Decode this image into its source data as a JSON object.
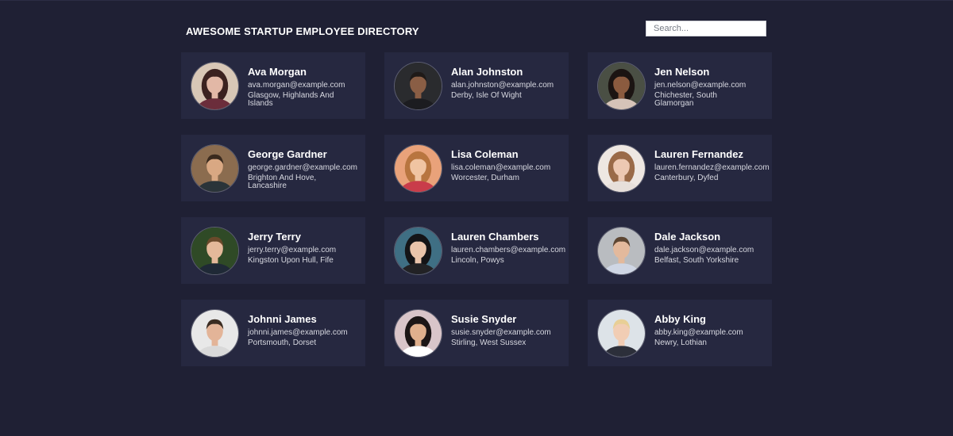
{
  "header": {
    "title": "AWESOME STARTUP EMPLOYEE DIRECTORY",
    "search_placeholder": "Search..."
  },
  "employees": [
    {
      "name": "Ava Morgan",
      "email": "ava.morgan@example.com",
      "location": "Glasgow, Highlands And Islands",
      "avatar": {
        "bg": "#d8c7b6",
        "hair": "#3b2220",
        "skin": "#e2b8a6",
        "shirt": "#6b2d3b",
        "long_hair": true
      }
    },
    {
      "name": "Alan Johnston",
      "email": "alan.johnston@example.com",
      "location": "Derby, Isle Of Wight",
      "avatar": {
        "bg": "#2a2b2e",
        "hair": "#1f1a18",
        "skin": "#8a5e45",
        "shirt": "#1c1c20",
        "long_hair": false
      }
    },
    {
      "name": "Jen Nelson",
      "email": "jen.nelson@example.com",
      "location": "Chichester, South Glamorgan",
      "avatar": {
        "bg": "#4a4f44",
        "hair": "#1b1412",
        "skin": "#8b5b3f",
        "shirt": "#d6c3b8",
        "long_hair": true
      }
    },
    {
      "name": "George Gardner",
      "email": "george.gardner@example.com",
      "location": "Brighton And Hove, Lancashire",
      "avatar": {
        "bg": "#8b6c4f",
        "hair": "#3a2a1e",
        "skin": "#d9a883",
        "shirt": "#2a3439",
        "long_hair": false
      }
    },
    {
      "name": "Lisa Coleman",
      "email": "lisa.coleman@example.com",
      "location": "Worcester, Durham",
      "avatar": {
        "bg": "#e9a27a",
        "hair": "#b8753f",
        "skin": "#f0c4a2",
        "shirt": "#c93c4a",
        "long_hair": true
      }
    },
    {
      "name": "Lauren Fernandez",
      "email": "lauren.fernandez@example.com",
      "location": "Canterbury, Dyfed",
      "avatar": {
        "bg": "#eee7e2",
        "hair": "#9a6a48",
        "skin": "#edc8b2",
        "shirt": "#e7dfda",
        "long_hair": true
      }
    },
    {
      "name": "Jerry Terry",
      "email": "jerry.terry@example.com",
      "location": "Kingston Upon Hull, Fife",
      "avatar": {
        "bg": "#2f4a26",
        "hair": "#6a4a2b",
        "skin": "#e4b99a",
        "shirt": "#1f2936",
        "long_hair": false
      }
    },
    {
      "name": "Lauren Chambers",
      "email": "lauren.chambers@example.com",
      "location": "Lincoln, Powys",
      "avatar": {
        "bg": "#3f6f84",
        "hair": "#141417",
        "skin": "#e9c4ab",
        "shirt": "#222225",
        "long_hair": true
      }
    },
    {
      "name": "Dale Jackson",
      "email": "dale.jackson@example.com",
      "location": "Belfast, South Yorkshire",
      "avatar": {
        "bg": "#b9bcc0",
        "hair": "#5d4632",
        "skin": "#e3b99c",
        "shirt": "#cfd6e4",
        "long_hair": false
      }
    },
    {
      "name": "Johnni James",
      "email": "johnni.james@example.com",
      "location": "Portsmouth, Dorset",
      "avatar": {
        "bg": "#e8e8e8",
        "hair": "#3a2c22",
        "skin": "#e3b498",
        "shirt": "#d9d9d9",
        "long_hair": false
      }
    },
    {
      "name": "Susie Snyder",
      "email": "susie.snyder@example.com",
      "location": "Stirling, West Sussex",
      "avatar": {
        "bg": "#d9c5c9",
        "hair": "#1c1616",
        "skin": "#e0b08d",
        "shirt": "#ffffff",
        "long_hair": true
      }
    },
    {
      "name": "Abby King",
      "email": "abby.king@example.com",
      "location": "Newry, Lothian",
      "avatar": {
        "bg": "#dde3e8",
        "hair": "#e8cf96",
        "skin": "#f1cdb4",
        "shirt": "#2c2f3a",
        "long_hair": false
      }
    }
  ]
}
